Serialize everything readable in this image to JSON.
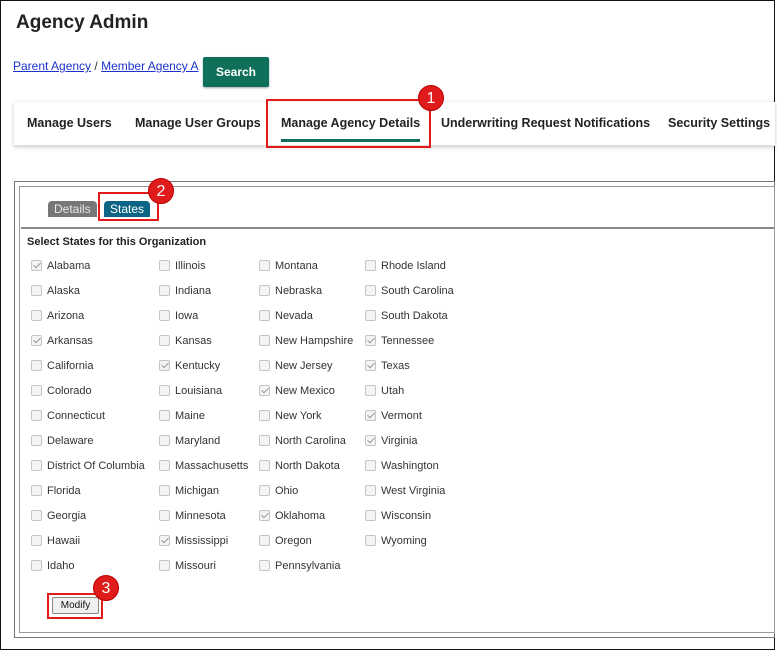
{
  "page": {
    "title": "Agency Admin"
  },
  "breadcrumb": {
    "parent": "Parent Agency",
    "separator": "/",
    "member": "Member Agency A"
  },
  "search": {
    "label": "Search"
  },
  "tabs": [
    {
      "label": "Manage Users",
      "active": false
    },
    {
      "label": "Manage User Groups",
      "active": false
    },
    {
      "label": "Manage Agency Details",
      "active": true
    },
    {
      "label": "Underwriting Request Notifications",
      "active": false
    },
    {
      "label": "Security Settings",
      "active": false
    }
  ],
  "subtabs": {
    "details": "Details",
    "states": "States"
  },
  "states_section": {
    "heading": "Select States for this Organization",
    "columns": [
      [
        {
          "name": "Alabama",
          "checked": true
        },
        {
          "name": "Alaska",
          "checked": false
        },
        {
          "name": "Arizona",
          "checked": false
        },
        {
          "name": "Arkansas",
          "checked": true
        },
        {
          "name": "California",
          "checked": false
        },
        {
          "name": "Colorado",
          "checked": false
        },
        {
          "name": "Connecticut",
          "checked": false
        },
        {
          "name": "Delaware",
          "checked": false
        },
        {
          "name": "District Of Columbia",
          "checked": false
        },
        {
          "name": "Florida",
          "checked": false
        },
        {
          "name": "Georgia",
          "checked": false
        },
        {
          "name": "Hawaii",
          "checked": false
        },
        {
          "name": "Idaho",
          "checked": false
        }
      ],
      [
        {
          "name": "Illinois",
          "checked": false
        },
        {
          "name": "Indiana",
          "checked": false
        },
        {
          "name": "Iowa",
          "checked": false
        },
        {
          "name": "Kansas",
          "checked": false
        },
        {
          "name": "Kentucky",
          "checked": true
        },
        {
          "name": "Louisiana",
          "checked": false
        },
        {
          "name": "Maine",
          "checked": false
        },
        {
          "name": "Maryland",
          "checked": false
        },
        {
          "name": "Massachusetts",
          "checked": false
        },
        {
          "name": "Michigan",
          "checked": false
        },
        {
          "name": "Minnesota",
          "checked": false
        },
        {
          "name": "Mississippi",
          "checked": true
        },
        {
          "name": "Missouri",
          "checked": false
        }
      ],
      [
        {
          "name": "Montana",
          "checked": false
        },
        {
          "name": "Nebraska",
          "checked": false
        },
        {
          "name": "Nevada",
          "checked": false
        },
        {
          "name": "New Hampshire",
          "checked": false
        },
        {
          "name": "New Jersey",
          "checked": false
        },
        {
          "name": "New Mexico",
          "checked": true
        },
        {
          "name": "New York",
          "checked": false
        },
        {
          "name": "North Carolina",
          "checked": false
        },
        {
          "name": "North Dakota",
          "checked": false
        },
        {
          "name": "Ohio",
          "checked": false
        },
        {
          "name": "Oklahoma",
          "checked": true
        },
        {
          "name": "Oregon",
          "checked": false
        },
        {
          "name": "Pennsylvania",
          "checked": false
        }
      ],
      [
        {
          "name": "Rhode Island",
          "checked": false
        },
        {
          "name": "South Carolina",
          "checked": false
        },
        {
          "name": "South Dakota",
          "checked": false
        },
        {
          "name": "Tennessee",
          "checked": true
        },
        {
          "name": "Texas",
          "checked": true
        },
        {
          "name": "Utah",
          "checked": false
        },
        {
          "name": "Vermont",
          "checked": true
        },
        {
          "name": "Virginia",
          "checked": true
        },
        {
          "name": "Washington",
          "checked": false
        },
        {
          "name": "West Virginia",
          "checked": false
        },
        {
          "name": "Wisconsin",
          "checked": false
        },
        {
          "name": "Wyoming",
          "checked": false
        }
      ]
    ]
  },
  "modify": {
    "label": "Modify"
  },
  "annotations": {
    "step1": "1",
    "step2": "2",
    "step3": "3"
  },
  "colors": {
    "accent": "#0f6f5a",
    "annotation": "#e01b1b",
    "active_subtab": "#0d6585"
  }
}
